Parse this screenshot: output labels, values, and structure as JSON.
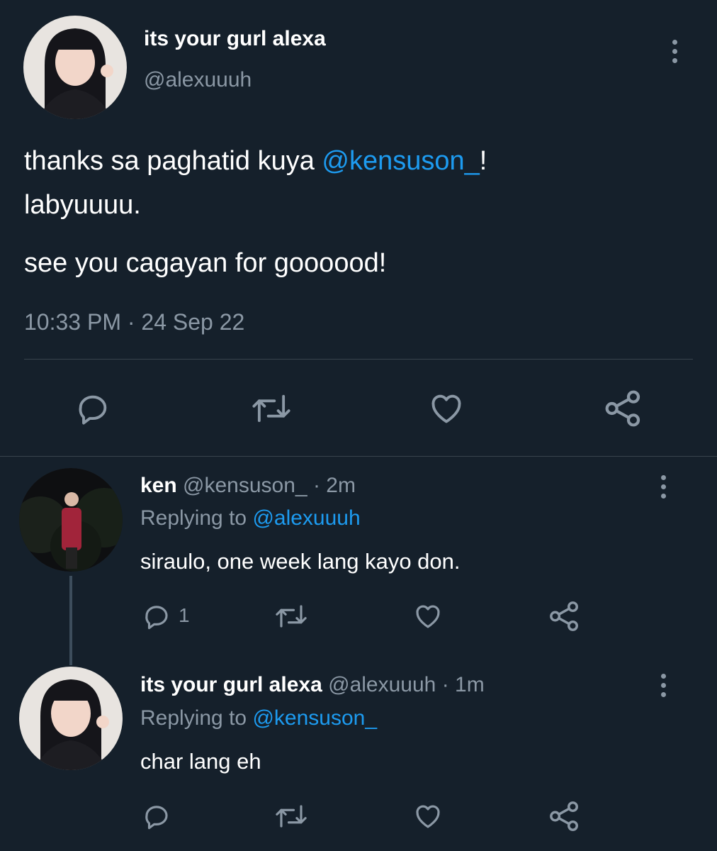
{
  "main_tweet": {
    "display_name": "its your gurl alexa",
    "handle": "@alexuuuh",
    "text_part1": "thanks sa paghatid kuya ",
    "mention": "@kensuson_",
    "text_part2": "!",
    "text_line2": "labyuuuu.",
    "text_line3": "see you cagayan for goooood!",
    "timestamp": "10:33 PM · 24 Sep 22"
  },
  "reply1": {
    "display_name": "ken",
    "handle": "@kensuson_",
    "time": "· 2m",
    "replying_prefix": "Replying to",
    "replying_handle": "@alexuuuh",
    "text": "siraulo, one week lang kayo don.",
    "reply_count": "1"
  },
  "reply2": {
    "display_name": "its your gurl alexa",
    "handle": "@alexuuuh",
    "time": "· 1m",
    "replying_prefix": "Replying to",
    "replying_handle": "@kensuson_",
    "text": "char lang eh"
  },
  "colors": {
    "background": "#15202b",
    "text": "#ffffff",
    "muted": "#8b98a5",
    "link": "#1d9bf0",
    "divider": "#38444d"
  },
  "icons": [
    "reply-icon",
    "retweet-icon",
    "like-icon",
    "share-icon",
    "more-icon"
  ]
}
